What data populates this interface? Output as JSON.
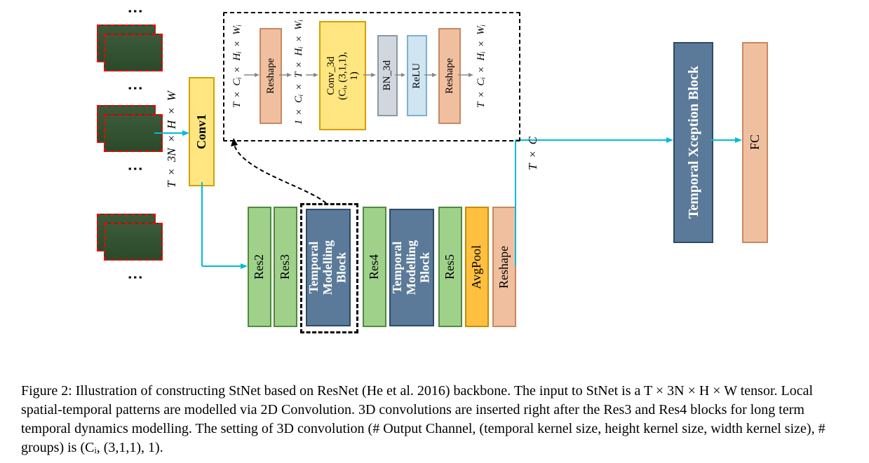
{
  "input_dim": "T × 3N × H × W",
  "conv1": "Conv1",
  "res2": "Res2",
  "res3": "Res3",
  "res4": "Res4",
  "res5": "Res5",
  "tmb": "Temporal\nModelling\nBlock",
  "avgpool": "AvgPool",
  "reshape": "Reshape",
  "txc": "T × C",
  "txb": "Temporal Xception Block",
  "fc": "FC",
  "detail": {
    "dim1": "T × Cᵢ × Hᵢ × Wᵢ",
    "reshape": "Reshape",
    "dim2": "1 × Cᵢ × T × Hᵢ × Wᵢ",
    "conv3d": "Conv_3d\n(Cᵢ, (3,1,1),\n1)",
    "bn3d": "BN_3d",
    "relu": "ReLU",
    "reshape2": "Reshape",
    "dim3": "T × Cᵢ × Hᵢ × Wᵢ"
  },
  "caption": "Figure 2: Illustration of constructing StNet based on ResNet (He et al. 2016) backbone. The input to StNet is a T × 3N × H × W tensor. Local spatial-temporal patterns are modelled via 2D Convolution. 3D convolutions are inserted right after the Res3 and Res4 blocks for long term temporal dynamics modelling. The setting of 3D convolution (# Output Channel, (temporal kernel size, height kernel size, width kernel size), # groups) is (Cᵢ, (3,1,1), 1)."
}
